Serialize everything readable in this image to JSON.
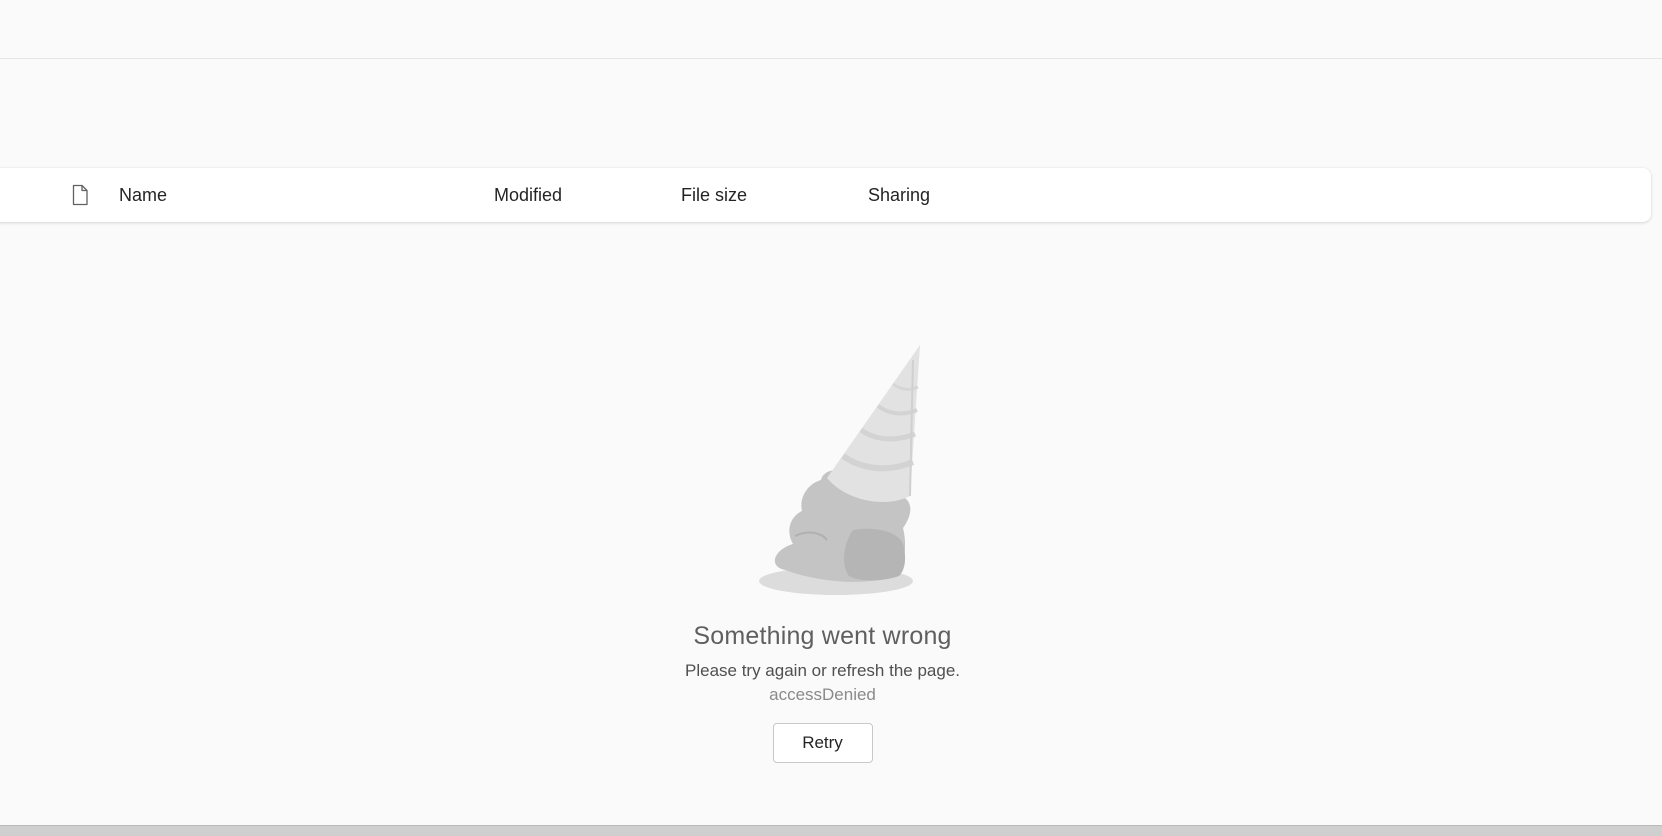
{
  "list_header": {
    "type_icon": "document-icon",
    "columns": {
      "name": "Name",
      "modified": "Modified",
      "file_size": "File size",
      "sharing": "Sharing"
    }
  },
  "error": {
    "illustration_icon": "melted-ice-cream-icon",
    "title": "Something went wrong",
    "message": "Please try again or refresh the page.",
    "code": "accessDenied",
    "retry_label": "Retry"
  },
  "colors": {
    "background": "#fafafa",
    "header_background": "#ffffff",
    "text_primary": "#242424",
    "text_muted": "#8a8a8a"
  }
}
